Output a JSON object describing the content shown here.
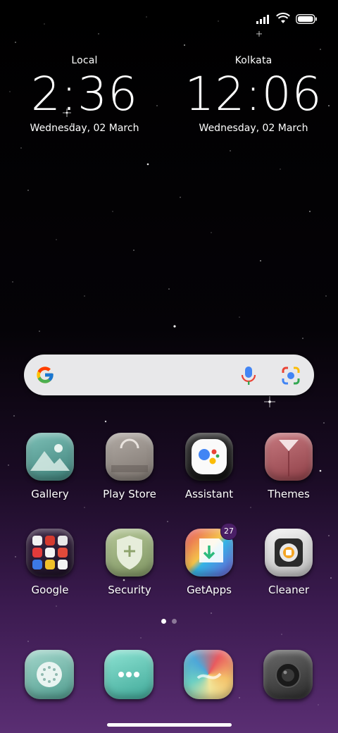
{
  "status_bar": {
    "icons": [
      "signal-icon",
      "wifi-icon",
      "battery-icon"
    ]
  },
  "clocks": [
    {
      "city": "Local",
      "time": "2:36",
      "date": "Wednesday, 02 March"
    },
    {
      "city": "Kolkata",
      "time": "12:06",
      "date": "Wednesday, 02 March"
    }
  ],
  "search": {
    "icons": [
      "google-g-icon",
      "microphone-icon",
      "lens-camera-icon"
    ]
  },
  "apps_row1": [
    {
      "label": "Gallery"
    },
    {
      "label": "Play Store"
    },
    {
      "label": "Assistant"
    },
    {
      "label": "Themes"
    }
  ],
  "apps_row2": [
    {
      "label": "Google"
    },
    {
      "label": "Security"
    },
    {
      "label": "GetApps",
      "badge": "27"
    },
    {
      "label": "Cleaner"
    }
  ],
  "page_indicator": {
    "pages": 2,
    "current": 1
  },
  "dock": {
    "icons": [
      "phone-dialer-icon",
      "messages-icon",
      "browser-icon",
      "camera-icon"
    ]
  },
  "colors": {
    "background_top": "#000000",
    "background_bottom": "#5a2e73",
    "search_bar": "#e8e8ea",
    "badge": "#4a1f66"
  }
}
